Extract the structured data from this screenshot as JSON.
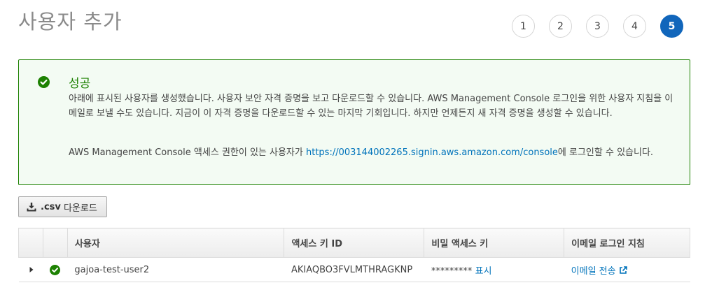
{
  "page": {
    "title": "사용자 추가"
  },
  "steps": [
    "1",
    "2",
    "3",
    "4",
    "5"
  ],
  "alert": {
    "title": "성공",
    "body": "아래에 표시된 사용자를 생성했습니다. 사용자 보안 자격 증명을 보고 다운로드할 수 있습니다. AWS Management Console 로그인을 위한 사용자 지침을 이메일로 보낼 수도 있습니다. 지금이 이 자격 증명을 다운로드할 수 있는 마지막 기회입니다. 하지만 언제든지 새 자격 증명을 생성할 수 있습니다.",
    "login_prefix": "AWS Management Console 액세스 권한이 있는 사용자가 ",
    "login_url": "https://003144002265.signin.aws.amazon.com/console",
    "login_suffix": "에 로그인할 수 있습니다."
  },
  "toolbar": {
    "csv_ext": ".csv",
    "csv_label": " 다운로드"
  },
  "table": {
    "headers": {
      "user": "사용자",
      "access_key": "액세스 키 ID",
      "secret_key": "비밀 액세스 키",
      "email": "이메일 로그인 지침"
    },
    "rows": [
      {
        "user": "gajoa-test-user2",
        "access_key": "AKIAQBO3FVLMTHRAGKNP",
        "secret_masked": "*********",
        "secret_show": "표시",
        "email_send": "이메일 전송"
      }
    ]
  },
  "icons": {
    "success": "check-circle-icon",
    "download": "download-icon",
    "expand": "caret-right-icon",
    "external": "external-link-icon"
  },
  "colors": {
    "success_green": "#1d8102",
    "success_bg": "#f3fbf3",
    "link_blue": "#0073bb",
    "step_active": "#1166bb"
  }
}
